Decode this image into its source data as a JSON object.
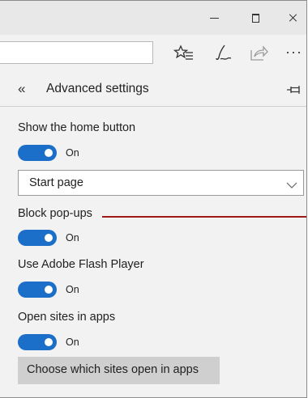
{
  "panel": {
    "title": "Advanced settings",
    "back_icon": "double-chevron-left-icon",
    "pin_icon": "pin-icon"
  },
  "toolbar": {
    "icons": [
      "favorites-list-icon",
      "pen-note-icon",
      "share-icon",
      "more-icon"
    ],
    "more_glyph": "···"
  },
  "settings": {
    "home_button": {
      "label": "Show the home button",
      "state": "On"
    },
    "home_page": {
      "value": "Start page"
    },
    "popups": {
      "label": "Block pop-ups",
      "state": "On"
    },
    "flash": {
      "label": "Use Adobe Flash Player",
      "state": "On"
    },
    "apps": {
      "label": "Open sites in apps",
      "state": "On"
    },
    "apps_button": "Choose which sites open in apps"
  },
  "colors": {
    "toggle_on": "#1c6fc9",
    "annotation_line": "#a01818",
    "panel_bg": "#f2f2f2"
  }
}
